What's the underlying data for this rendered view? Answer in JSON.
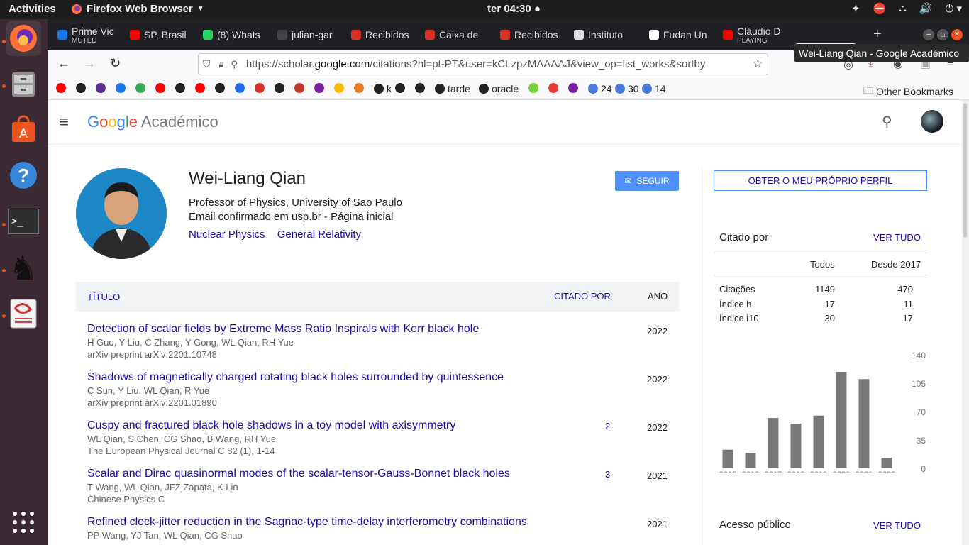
{
  "os": {
    "activities": "Activities",
    "app_name": "Firefox Web Browser",
    "clock": "ter 04:30"
  },
  "tabs": [
    {
      "title": "Prime Vic",
      "sub": "MUTED",
      "color": "#1a73e8"
    },
    {
      "title": "SP, Brasil",
      "sub": "",
      "color": "#ff0000"
    },
    {
      "title": "(8) Whats",
      "sub": "",
      "color": "#25d366"
    },
    {
      "title": "julian-gar",
      "sub": "",
      "color": "#444444"
    },
    {
      "title": "Recibidos",
      "sub": "",
      "color": "#d93025"
    },
    {
      "title": "Caixa de",
      "sub": "",
      "color": "#d93025"
    },
    {
      "title": "Recibidos",
      "sub": "",
      "color": "#d93025"
    },
    {
      "title": "Instituto",
      "sub": "",
      "color": "#dddddd"
    },
    {
      "title": "Fudan Un",
      "sub": "",
      "color": "#ffffff"
    },
    {
      "title": "Cláudio D",
      "sub": "PLAYING",
      "color": "#ff0000"
    },
    {
      "title": "Wei-Li",
      "sub": "",
      "color": "#4285f4"
    }
  ],
  "address": {
    "url_pre": "https://scholar.",
    "url_host": "google.com",
    "url_post": "/citations?hl=pt-PT&user=kCLzpzMAAAAJ&view_op=list_works&sortby"
  },
  "tooltip": "Wei-Liang Qian - Google Académico",
  "bookmarks": [
    {
      "label": "",
      "color": "#ff0000"
    },
    {
      "label": "",
      "color": "#222222"
    },
    {
      "label": "",
      "color": "#5b2d8e"
    },
    {
      "label": "",
      "color": "#1a73e8"
    },
    {
      "label": "",
      "color": "#34a853"
    },
    {
      "label": "",
      "color": "#ff0000"
    },
    {
      "label": "",
      "color": "#222222"
    },
    {
      "label": "",
      "color": "#ff0000"
    },
    {
      "label": "",
      "color": "#222222"
    },
    {
      "label": "",
      "color": "#1f6feb"
    },
    {
      "label": "",
      "color": "#d93025"
    },
    {
      "label": "",
      "color": "#222222"
    },
    {
      "label": "",
      "color": "#c0392b"
    },
    {
      "label": "",
      "color": "#7b1fa2"
    },
    {
      "label": "",
      "color": "#fbbc04"
    },
    {
      "label": "",
      "color": "#e67e22"
    },
    {
      "label": "k",
      "color": "#222222"
    },
    {
      "label": "",
      "color": "#222222"
    },
    {
      "label": "",
      "color": "#222222"
    },
    {
      "label": "tarde",
      "color": "#222222"
    },
    {
      "label": "oracle",
      "color": "#222222"
    },
    {
      "label": "",
      "color": "#7cd23a"
    },
    {
      "label": "",
      "color": "#e53935"
    },
    {
      "label": "",
      "color": "#7b1fa2"
    },
    {
      "label": "24",
      "color": "#4a7bdc"
    },
    {
      "label": "30",
      "color": "#4a7bdc"
    },
    {
      "label": "14",
      "color": "#4a7bdc"
    }
  ],
  "other_bookmarks": "Other Bookmarks",
  "scholar": {
    "logo_google": "Google",
    "logo_product": "Académico",
    "name": "Wei-Liang Qian",
    "affil_prefix": "Professor of Physics, ",
    "affil_link": "University of Sao Paulo",
    "email_prefix": "Email confirmado em usp.br - ",
    "homepage": "Página inicial",
    "interests": [
      "Nuclear Physics",
      "General Relativity"
    ],
    "follow": "SEGUIR",
    "get_profile": "OBTER O MEU PRÓPRIO PERFIL",
    "col_title": "TÍTULO",
    "col_cited": "CITADO POR",
    "col_year": "ANO",
    "papers": [
      {
        "title": "Detection of scalar fields by Extreme Mass Ratio Inspirals with Kerr black hole",
        "authors": "H Guo, Y Liu, C Zhang, Y Gong, WL Qian, RH Yue",
        "venue": "arXiv preprint arXiv:2201.10748",
        "cited": "",
        "year": "2022"
      },
      {
        "title": "Shadows of magnetically charged rotating black holes surrounded by quintessence",
        "authors": "C Sun, Y Liu, WL Qian, R Yue",
        "venue": "arXiv preprint arXiv:2201.01890",
        "cited": "",
        "year": "2022"
      },
      {
        "title": "Cuspy and fractured black hole shadows in a toy model with axisymmetry",
        "authors": "WL Qian, S Chen, CG Shao, B Wang, RH Yue",
        "venue": "The European Physical Journal C 82 (1), 1-14",
        "cited": "2",
        "year": "2022"
      },
      {
        "title": "Scalar and Dirac quasinormal modes of the scalar-tensor-Gauss-Bonnet black holes",
        "authors": "T Wang, WL Qian, JFZ Zapata, K Lin",
        "venue": "Chinese Physics C",
        "cited": "3",
        "year": "2021"
      },
      {
        "title": "Refined clock-jitter reduction in the Sagnac-type time-delay interferometry combinations",
        "authors": "PP Wang, YJ Tan, WL Qian, CG Shao",
        "venue": "",
        "cited": "",
        "year": "2021"
      }
    ],
    "cited_by": "Citado por",
    "view_all": "VER TUDO",
    "col_all": "Todos",
    "col_since": "Desde 2017",
    "metrics": [
      {
        "label": "Citações",
        "all": "1149",
        "since": "470"
      },
      {
        "label": "Índice h",
        "all": "17",
        "since": "11"
      },
      {
        "label": "Índice i10",
        "all": "30",
        "since": "17"
      }
    ],
    "public_access": "Acesso público",
    "public_view_all": "VER TUDO"
  },
  "chart_data": {
    "type": "bar",
    "categories": [
      "2015",
      "2016",
      "2017",
      "2018",
      "2019",
      "2020",
      "2021",
      "2022"
    ],
    "values": [
      23,
      19,
      62,
      55,
      65,
      119,
      110,
      13
    ],
    "ylim": [
      0,
      140
    ],
    "yticks": [
      "140",
      "105",
      "70",
      "35",
      "0"
    ],
    "bar_color": "#777777"
  }
}
